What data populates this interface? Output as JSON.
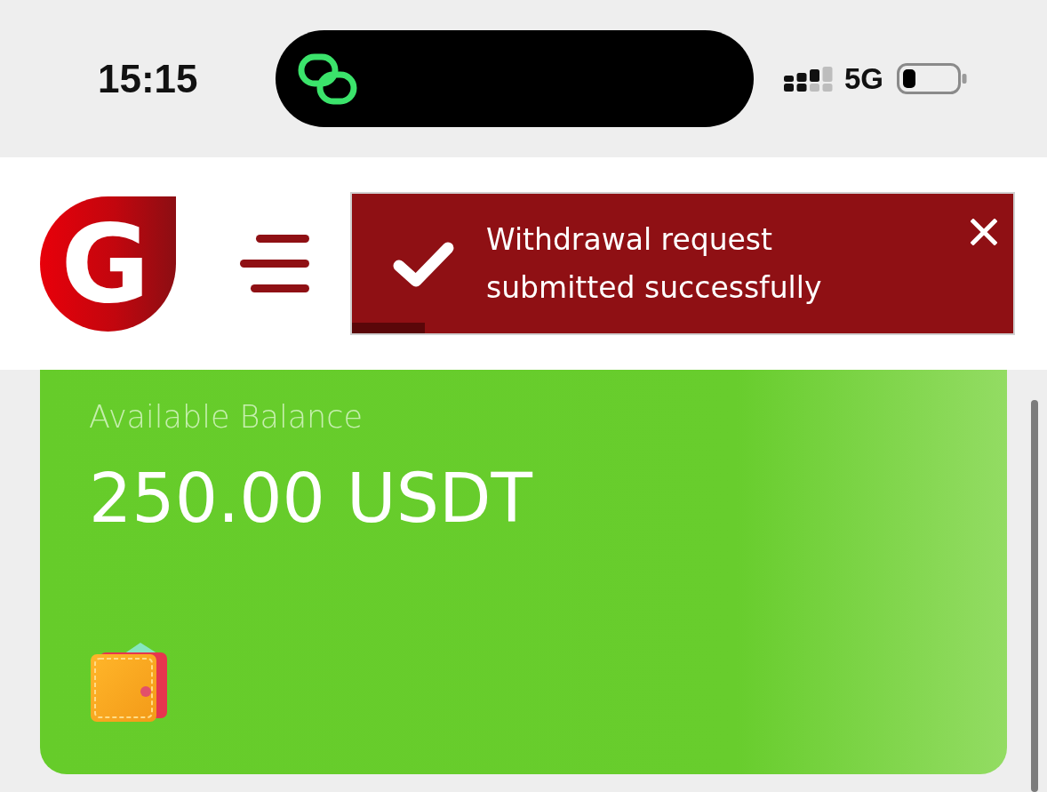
{
  "status_bar": {
    "time": "15:15",
    "network": "5G"
  },
  "header": {
    "logo": {
      "letter": "G"
    }
  },
  "toast": {
    "message": "Withdrawal request submitted successfully",
    "timer": {
      "level": 0.11
    }
  },
  "balance_card": {
    "label": "Available Balance",
    "amount": "250.00 USDT"
  }
}
